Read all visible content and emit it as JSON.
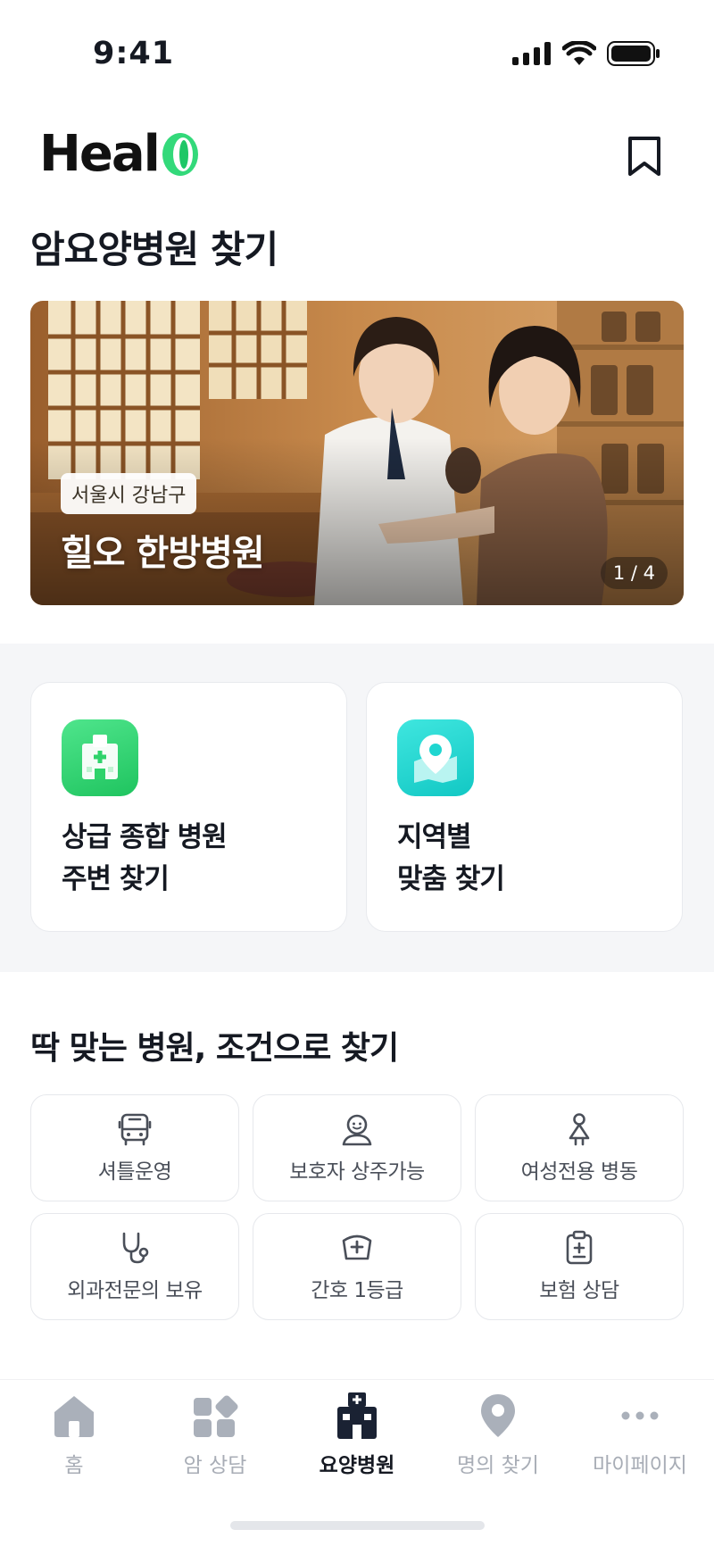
{
  "status": {
    "time": "9:41"
  },
  "app": {
    "logo_text": "Heal"
  },
  "page": {
    "title": "암요양병원 찾기"
  },
  "banner": {
    "location": "서울시 강남구",
    "name": "힐오 한방병원",
    "pager": "1 / 4"
  },
  "quick": [
    {
      "line1": "상급 종합 병원",
      "line2": "주변 찾기",
      "icon": "hospital-icon",
      "color": "#2fd36b"
    },
    {
      "line1": "지역별",
      "line2": "맞춤 찾기",
      "icon": "map-pin-icon",
      "color": "#1fd6d0"
    }
  ],
  "conditions": {
    "title": "딱 맞는 병원, 조건으로 찾기",
    "items": [
      {
        "label": "셔틀운영",
        "icon": "bus-icon"
      },
      {
        "label": "보호자 상주가능",
        "icon": "guardian-icon"
      },
      {
        "label": "여성전용 병동",
        "icon": "woman-icon"
      },
      {
        "label": "외과전문의 보유",
        "icon": "stethoscope-icon"
      },
      {
        "label": "간호 1등급",
        "icon": "nurse-cap-icon"
      },
      {
        "label": "보험 상담",
        "icon": "clipboard-icon"
      }
    ]
  },
  "tabs": [
    {
      "label": "홈",
      "icon": "home-icon"
    },
    {
      "label": "암 상담",
      "icon": "grid-icon"
    },
    {
      "label": "요양병원",
      "icon": "hospital-icon",
      "active": true
    },
    {
      "label": "명의 찾기",
      "icon": "location-icon"
    },
    {
      "label": "마이페이지",
      "icon": "more-icon"
    }
  ]
}
